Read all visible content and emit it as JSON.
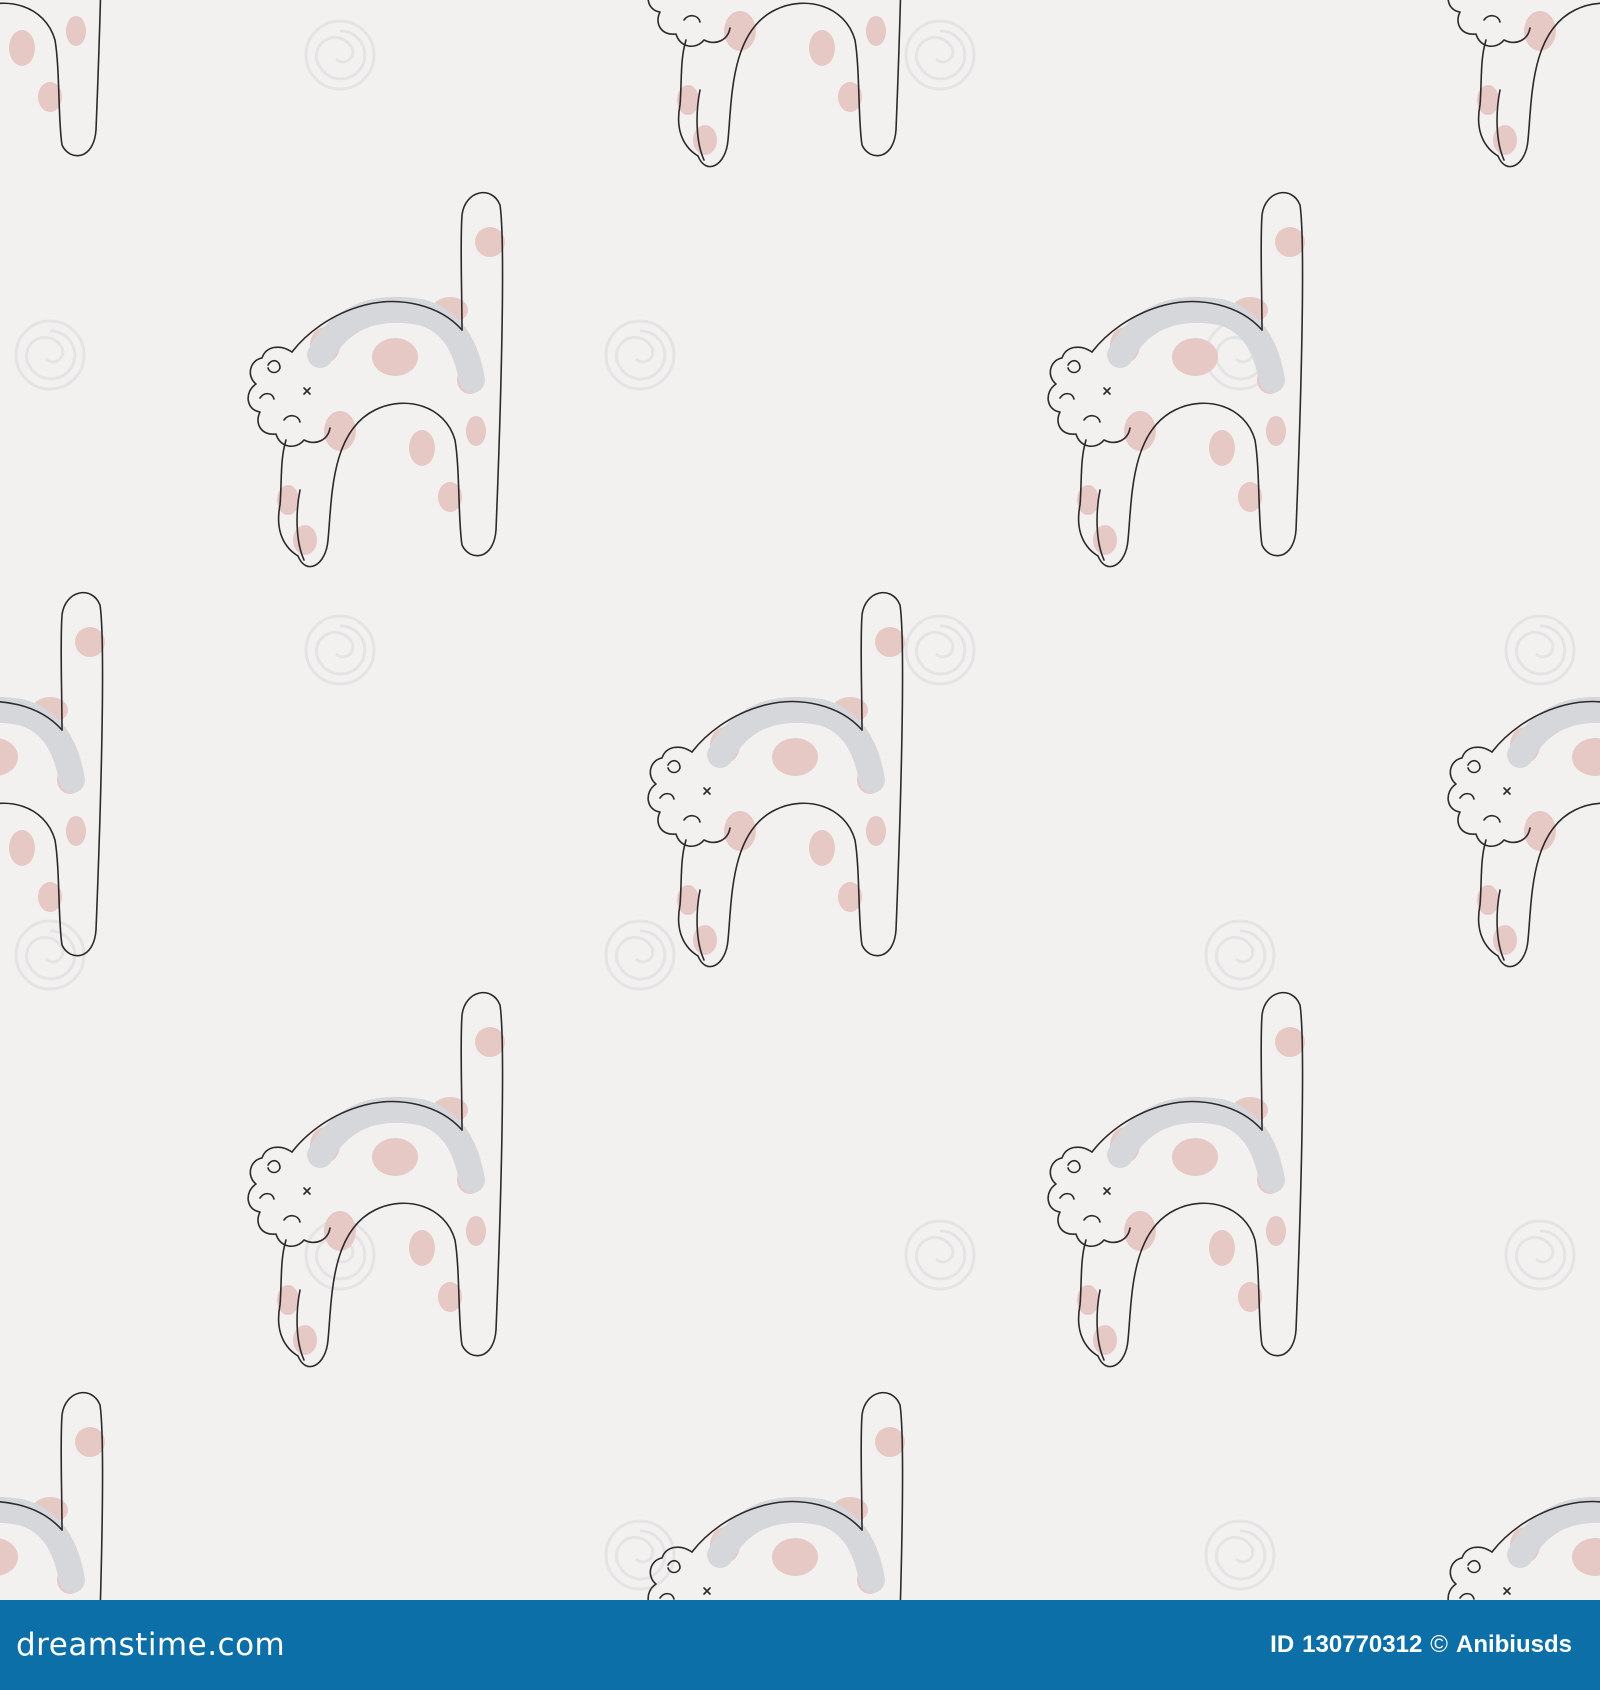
{
  "colors": {
    "background": "#f3f1f0",
    "footer": "#0d6fa8",
    "footer_text": "#ffffff",
    "outline": "#2a2a2a",
    "spots": "#e6c9c4",
    "back_stripe": "#d5d7da",
    "watermark": "#e4e4e4"
  },
  "pattern": {
    "motif_icon": "spotted-cat-icon",
    "watermark_icon": "spiral-watermark-icon"
  },
  "footer": {
    "brand": "dreamstime.com",
    "id_label": "ID",
    "id_value": "130770312",
    "copyright_icon": "©",
    "author": "Anibiusds"
  }
}
